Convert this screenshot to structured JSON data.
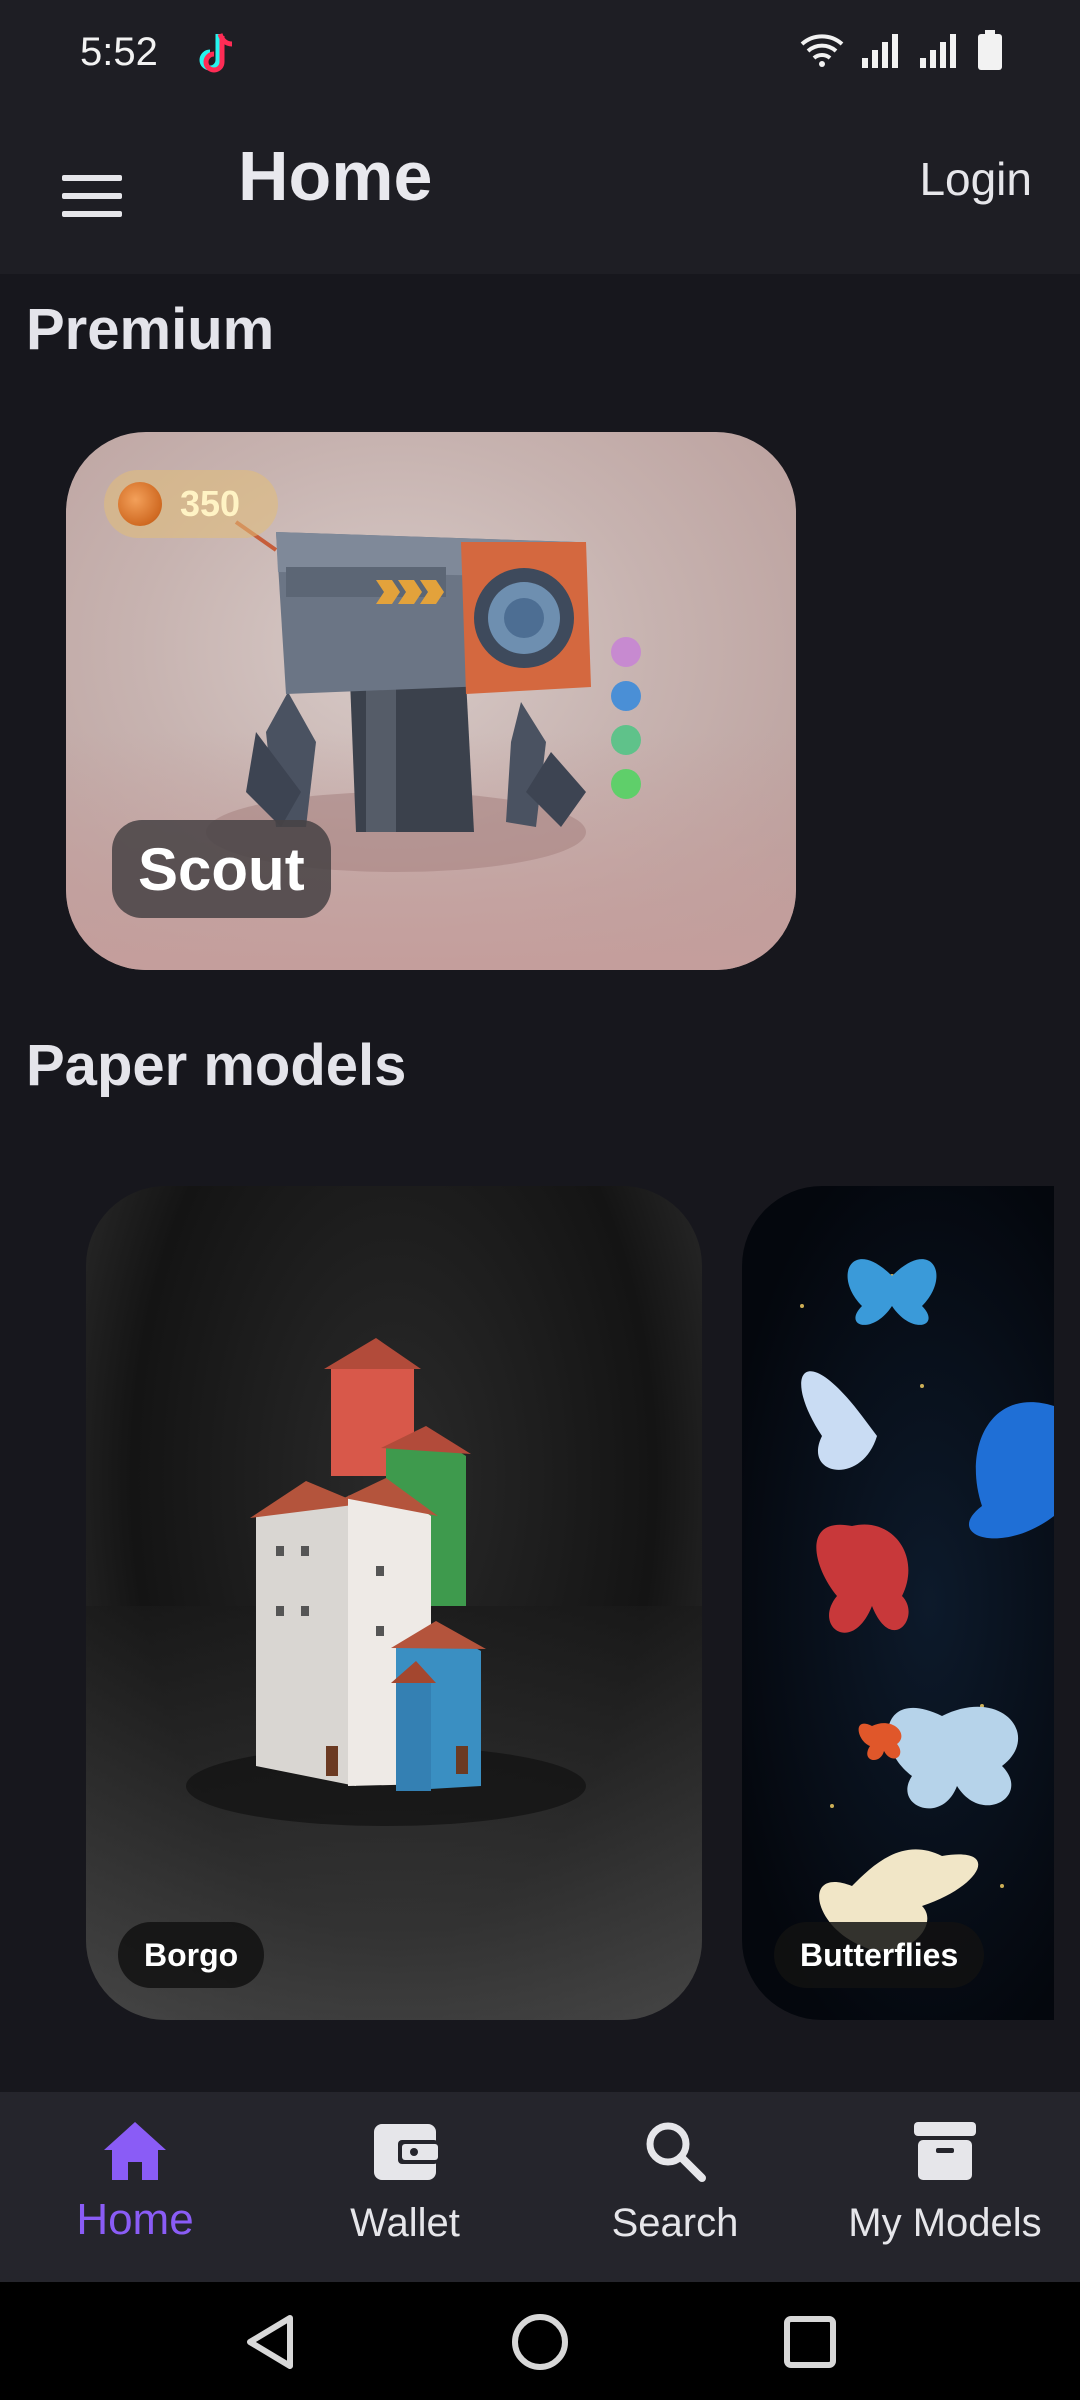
{
  "status_bar": {
    "time": "5:52",
    "app_icon": "tiktok-icon",
    "icons": [
      "wifi-icon",
      "signal-icon",
      "signal-icon",
      "battery-icon"
    ]
  },
  "app_bar": {
    "menu_icon": "hamburger-menu-icon",
    "title": "Home",
    "login_label": "Login"
  },
  "premium": {
    "section_title": "Premium",
    "card": {
      "price": "350",
      "price_icon": "coin-icon",
      "name": "Scout",
      "color_options": [
        "#c78ad0",
        "#4a8fd6",
        "#5fc28a",
        "#5fcf6a"
      ]
    }
  },
  "paper_models": {
    "section_title": "Paper models",
    "cards": [
      {
        "name": "Borgo"
      },
      {
        "name": "Butterflies"
      }
    ]
  },
  "bottom_nav": {
    "items": [
      {
        "label": "Home",
        "icon": "home-icon",
        "active": true
      },
      {
        "label": "Wallet",
        "icon": "wallet-icon",
        "active": false
      },
      {
        "label": "Search",
        "icon": "search-icon",
        "active": false
      },
      {
        "label": "My Models",
        "icon": "archive-box-icon",
        "active": false
      }
    ]
  },
  "colors": {
    "accent": "#8a5cf6",
    "background": "#17171d",
    "bar": "#1e1e24"
  }
}
